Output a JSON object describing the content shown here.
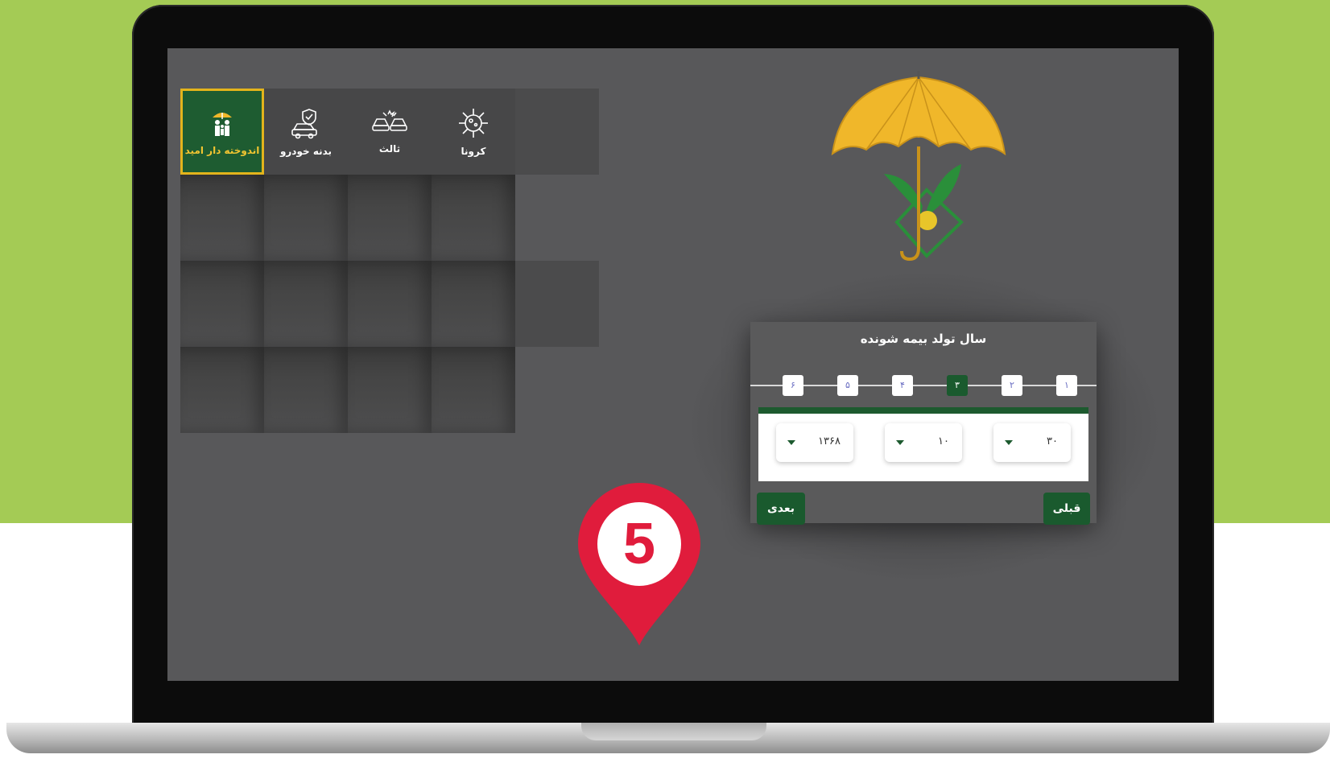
{
  "colors": {
    "background": "#a4cb55",
    "screen": "#58585a",
    "accent_green": "#1a5a2e",
    "accent_yellow": "#e3b41c",
    "pin_red": "#e01c3c"
  },
  "menu": {
    "items": [
      {
        "label": "اندوخته دار امید",
        "icon": "family-umbrella-icon",
        "selected": true
      },
      {
        "label": "بدنه خودرو",
        "icon": "car-shield-icon",
        "selected": false
      },
      {
        "label": "ثالث",
        "icon": "car-crash-icon",
        "selected": false
      },
      {
        "label": "کرونا",
        "icon": "virus-icon",
        "selected": false
      }
    ]
  },
  "form": {
    "title": "سال تولد بیمه شونده",
    "steps": [
      "۱",
      "۲",
      "۳",
      "۴",
      "۵",
      "۶"
    ],
    "active_step": "۳",
    "day": "۳۰",
    "month": "۱۰",
    "year": "۱۳۶۸",
    "prev_label": "قبلی",
    "next_label": "بعدی"
  },
  "pin": {
    "number": "5"
  }
}
